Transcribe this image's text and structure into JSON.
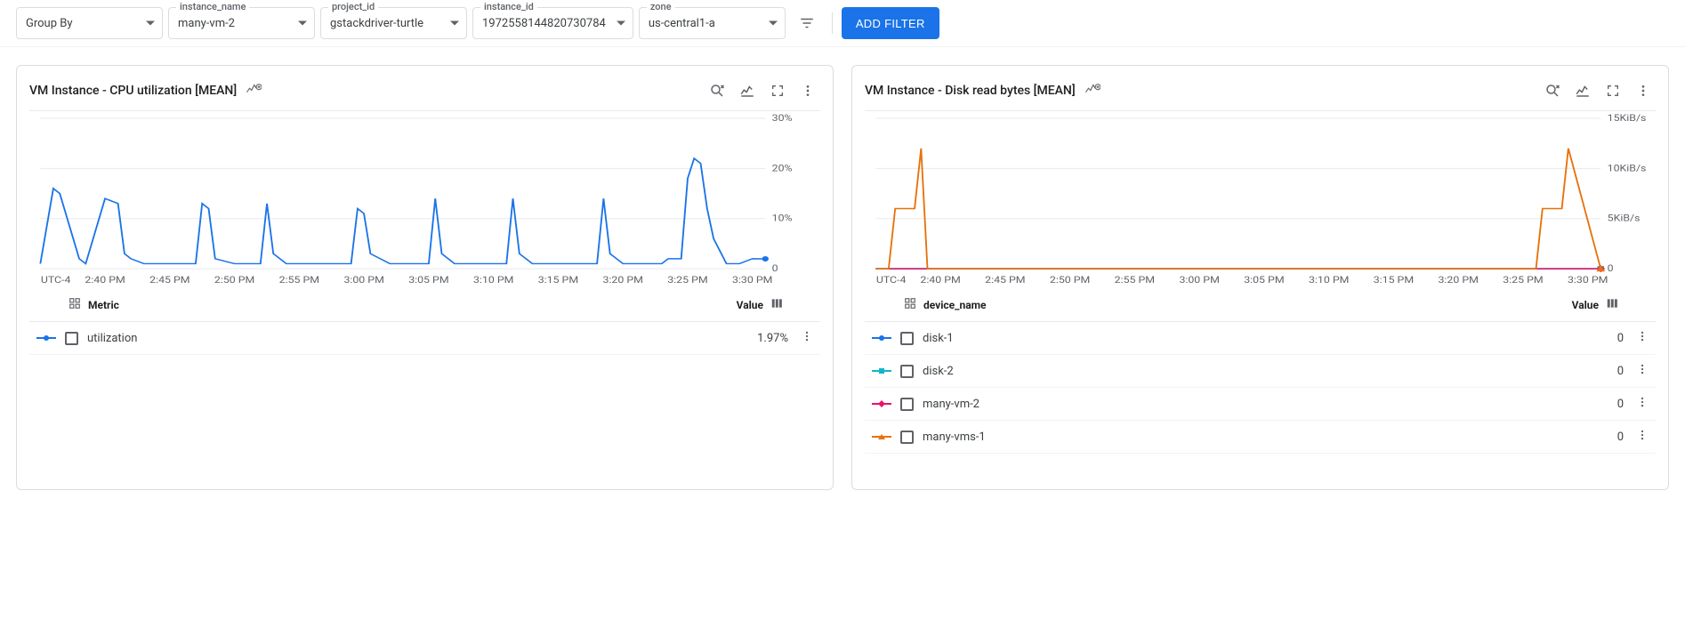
{
  "filters": {
    "group_by": {
      "placeholder": "Group By"
    },
    "instance_name": {
      "label": "instance_name",
      "value": "many-vm-2"
    },
    "project_id": {
      "label": "project_id",
      "value": "gstackdriver-turtle"
    },
    "instance_id": {
      "label": "instance_id",
      "value": "1972558144820730784"
    },
    "zone": {
      "label": "zone",
      "value": "us-central1-a"
    },
    "add_filter_label": "ADD FILTER"
  },
  "time_axis": {
    "tz": "UTC-4",
    "ticks": [
      "2:40 PM",
      "2:45 PM",
      "2:50 PM",
      "2:55 PM",
      "3:00 PM",
      "3:05 PM",
      "3:10 PM",
      "3:15 PM",
      "3:20 PM",
      "3:25 PM",
      "3:30 PM"
    ]
  },
  "cards": [
    {
      "title": "VM Instance - CPU utilization [MEAN]",
      "yticks": [
        "30%",
        "20%",
        "10%",
        "0"
      ],
      "legend_header": {
        "metric": "Metric",
        "value": "Value"
      },
      "legend_rows": [
        {
          "name": "utilization",
          "value": "1.97%",
          "color": "#1a73e8",
          "marker": "circle"
        }
      ]
    },
    {
      "title": "VM Instance - Disk read bytes [MEAN]",
      "yticks": [
        "15KiB/s",
        "10KiB/s",
        "5KiB/s",
        "0"
      ],
      "legend_header": {
        "metric": "device_name",
        "value": "Value"
      },
      "legend_rows": [
        {
          "name": "disk-1",
          "value": "0",
          "color": "#1a73e8",
          "marker": "circle"
        },
        {
          "name": "disk-2",
          "value": "0",
          "color": "#12b5cb",
          "marker": "square"
        },
        {
          "name": "many-vm-2",
          "value": "0",
          "color": "#e8136d",
          "marker": "diamond"
        },
        {
          "name": "many-vms-1",
          "value": "0",
          "color": "#e8710a",
          "marker": "triangle"
        }
      ]
    }
  ],
  "chart_data": [
    {
      "type": "line",
      "title": "VM Instance - CPU utilization [MEAN]",
      "xlabel": "",
      "ylabel": "",
      "ylim": [
        0,
        30
      ],
      "x_ticks": [
        "2:40 PM",
        "2:45 PM",
        "2:50 PM",
        "2:55 PM",
        "3:00 PM",
        "3:05 PM",
        "3:10 PM",
        "3:15 PM",
        "3:20 PM",
        "3:25 PM",
        "3:30 PM"
      ],
      "series": [
        {
          "name": "utilization",
          "color": "#1a73e8",
          "x_minutes": [
            155,
            156,
            156.5,
            158,
            158.5,
            160,
            161,
            161.5,
            162,
            163,
            167,
            167.5,
            168,
            168.5,
            170,
            172,
            172.5,
            173,
            174,
            179,
            179.5,
            180,
            180.5,
            182,
            185,
            185.5,
            186,
            187,
            191,
            191.5,
            192,
            193,
            198,
            198.5,
            199,
            200,
            202,
            203,
            203.5,
            204.5,
            205,
            205.5,
            206,
            206.5,
            207,
            208,
            209,
            210,
            211
          ],
          "values": [
            1,
            16,
            15,
            2,
            1,
            14,
            13,
            3,
            2,
            1,
            1,
            13,
            12,
            2,
            1,
            1,
            13,
            3,
            1,
            1,
            12,
            11,
            3,
            1,
            1,
            14,
            3,
            1,
            1,
            14,
            3,
            1,
            1,
            14,
            3,
            1,
            1,
            1,
            2,
            2,
            18,
            22,
            21,
            12,
            6,
            1,
            1,
            2,
            1.97
          ]
        }
      ]
    },
    {
      "type": "line",
      "title": "VM Instance - Disk read bytes [MEAN]",
      "xlabel": "",
      "ylabel": "",
      "ylim": [
        0,
        15
      ],
      "y_unit": "KiB/s",
      "x_ticks": [
        "2:40 PM",
        "2:45 PM",
        "2:50 PM",
        "2:55 PM",
        "3:00 PM",
        "3:05 PM",
        "3:10 PM",
        "3:15 PM",
        "3:20 PM",
        "3:25 PM",
        "3:30 PM"
      ],
      "series": [
        {
          "name": "disk-1",
          "color": "#1a73e8",
          "x_minutes": [
            155,
            211
          ],
          "values": [
            0,
            0
          ]
        },
        {
          "name": "disk-2",
          "color": "#12b5cb",
          "x_minutes": [
            155,
            211
          ],
          "values": [
            0,
            0
          ]
        },
        {
          "name": "many-vm-2",
          "color": "#e8136d",
          "x_minutes": [
            155,
            211
          ],
          "values": [
            0,
            0
          ]
        },
        {
          "name": "many-vms-1",
          "color": "#e8710a",
          "x_minutes": [
            155,
            156,
            156.5,
            158,
            158.5,
            159,
            205,
            206,
            206.5,
            208,
            208.5,
            211
          ],
          "values": [
            0,
            0,
            6,
            6,
            12,
            0,
            0,
            0,
            6,
            6,
            12,
            0
          ]
        }
      ]
    }
  ]
}
